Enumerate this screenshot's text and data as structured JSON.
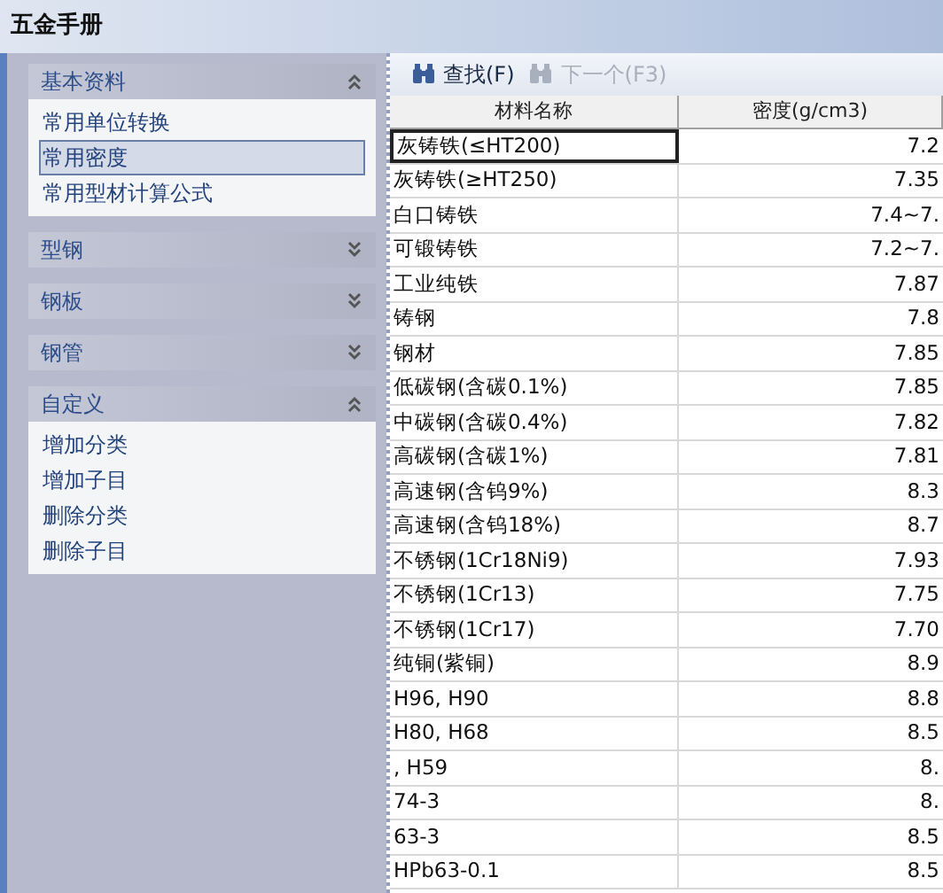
{
  "window": {
    "title": "五金手册"
  },
  "sidebar": {
    "groups": [
      {
        "label": "基本资料",
        "expanded": true,
        "items": [
          {
            "label": "常用单位转换",
            "selected": false
          },
          {
            "label": "常用密度",
            "selected": true
          },
          {
            "label": "常用型材计算公式",
            "selected": false
          }
        ]
      },
      {
        "label": "型钢",
        "expanded": false
      },
      {
        "label": "钢板",
        "expanded": false
      },
      {
        "label": "钢管",
        "expanded": false
      },
      {
        "label": "自定义",
        "expanded": true,
        "items": [
          {
            "label": "增加分类",
            "selected": false
          },
          {
            "label": "增加子目",
            "selected": false
          },
          {
            "label": "删除分类",
            "selected": false
          },
          {
            "label": "删除子目",
            "selected": false
          }
        ]
      }
    ]
  },
  "toolbar": [
    {
      "label": "查找(F)",
      "disabled": false
    },
    {
      "label": "下一个(F3)",
      "disabled": true
    }
  ],
  "table": {
    "columns": [
      "材料名称",
      "密度(g/cm3)"
    ],
    "rows": [
      {
        "name": "灰铸铁(≤HT200)",
        "density": "7.2",
        "selected": true
      },
      {
        "name": "灰铸铁(≥HT250)",
        "density": "7.35",
        "selected": false
      },
      {
        "name": "白口铸铁",
        "density": "7.4~7.",
        "selected": false
      },
      {
        "name": "可锻铸铁",
        "density": "7.2~7.",
        "selected": false
      },
      {
        "name": "工业纯铁",
        "density": "7.87",
        "selected": false
      },
      {
        "name": "铸钢",
        "density": "7.8",
        "selected": false
      },
      {
        "name": "钢材",
        "density": "7.85",
        "selected": false
      },
      {
        "name": "低碳钢(含碳0.1%)",
        "density": "7.85",
        "selected": false
      },
      {
        "name": "中碳钢(含碳0.4%)",
        "density": "7.82",
        "selected": false
      },
      {
        "name": "高碳钢(含碳1%)",
        "density": "7.81",
        "selected": false
      },
      {
        "name": "高速钢(含钨9%)",
        "density": "8.3",
        "selected": false
      },
      {
        "name": "高速钢(含钨18%)",
        "density": "8.7",
        "selected": false
      },
      {
        "name": "不锈钢(1Cr18Ni9)",
        "density": "7.93",
        "selected": false
      },
      {
        "name": "不锈钢(1Cr13)",
        "density": "7.75",
        "selected": false
      },
      {
        "name": "不锈钢(1Cr17)",
        "density": "7.70",
        "selected": false
      },
      {
        "name": "纯铜(紫铜)",
        "density": "8.9",
        "selected": false
      },
      {
        "name": "H96, H90",
        "density": "8.8",
        "selected": false
      },
      {
        "name": "H80, H68",
        "density": "8.5",
        "selected": false
      },
      {
        "name": ", H59",
        "density": "8.",
        "selected": false
      },
      {
        "name": "74-3",
        "density": "8.",
        "selected": false
      },
      {
        "name": "63-3",
        "density": "8.5",
        "selected": false
      },
      {
        "name": "HPb63-0.1",
        "density": "8.5",
        "selected": false
      }
    ]
  }
}
